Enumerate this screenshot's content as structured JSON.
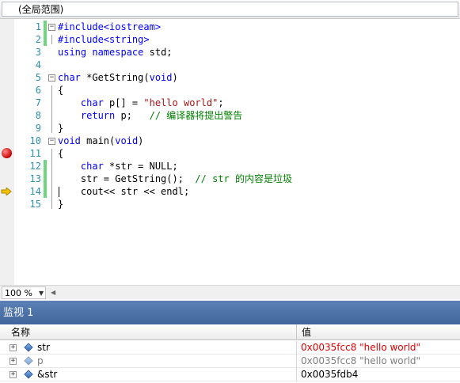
{
  "scope_label": "(全局范围)",
  "code_lines": [
    {
      "num": "1",
      "text": "#include<iostream>"
    },
    {
      "num": "2",
      "text": "#include<string>"
    },
    {
      "num": "3",
      "text": "using namespace std;"
    },
    {
      "num": "4",
      "text": ""
    },
    {
      "num": "5",
      "text": "char *GetString(void)"
    },
    {
      "num": "6",
      "text": "{"
    },
    {
      "num": "7",
      "text": "    char p[] = \"hello world\";"
    },
    {
      "num": "8",
      "text": "    return p;   // 编译器将提出警告"
    },
    {
      "num": "9",
      "text": "}"
    },
    {
      "num": "10",
      "text": "void main(void)"
    },
    {
      "num": "11",
      "text": "{"
    },
    {
      "num": "12",
      "text": "    char *str = NULL;"
    },
    {
      "num": "13",
      "text": "    str = GetString();  // str 的内容是垃圾"
    },
    {
      "num": "14",
      "text": "    cout<< str << endl;"
    },
    {
      "num": "15",
      "text": "}"
    }
  ],
  "zoom": "100 %",
  "watch": {
    "title": "监视 1",
    "col_name": "名称",
    "col_value": "值",
    "rows": [
      {
        "name": "str",
        "value": "0x0035fcc8 \"hello world\""
      },
      {
        "name": "p",
        "value": "0x0035fcc8 \"hello world\""
      },
      {
        "name": "&str",
        "value": "0x0035fdb4"
      }
    ]
  },
  "colors": {
    "keyword": "#0000ff",
    "string": "#a31515",
    "comment": "#008000",
    "line_number": "#2b91af",
    "changed_value": "#e00000",
    "stale_value": "#808080",
    "breakpoint": "#c80000",
    "execution_arrow": "#f5c400",
    "watch_titlebar": "#4a6fa5"
  },
  "icons": {
    "breakpoint": "breakpoint-icon",
    "current_line": "execution-arrow-icon",
    "variable": "variable-icon"
  }
}
